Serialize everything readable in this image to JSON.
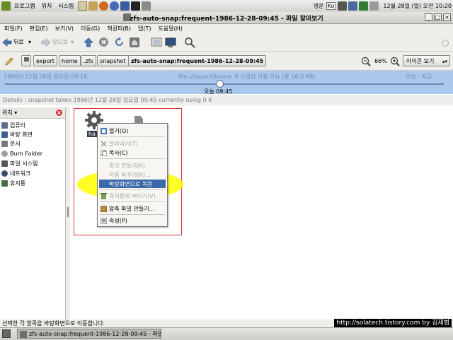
{
  "top_panel": {
    "menus": [
      "프로그램",
      "위치",
      "시스템"
    ],
    "right": {
      "user": "명운",
      "kb": "Ko",
      "date_time": "12월 28일 (일) 오전 10:20"
    }
  },
  "window": {
    "title": "zfs-auto-snap:frequent-1986-12-28-09:45 - 파일 찾아보기",
    "buttons": [
      "_",
      "□",
      "×"
    ]
  },
  "menubar": [
    "파일(F)",
    "편집(E)",
    "보기(V)",
    "이동(G)",
    "책갈피(B)",
    "탭(T)",
    "도움말(H)"
  ],
  "nav": {
    "back": "뒤로",
    "forward": "앞으로"
  },
  "location": {
    "crumbs": [
      "export",
      "home",
      ".zfs",
      "snapshot",
      "zfs-auto-snap:frequent-1986-12-28-09:45"
    ],
    "zoom": "66%",
    "view_mode": "아이콘 보기"
  },
  "timeline": {
    "left_date": "1986년 12월 28일 일요일 09:18",
    "center_info": "file:///export/home: 8 스냅샷 사용 가능 (총 16.0 KB)",
    "right_date": "오늘 - 지금",
    "current_time": "오늘 09:45",
    "position_fraction": 0.485
  },
  "details": "Details : snapshot taken 1986년 12월 28일 일요일 09:45 currently using 0 K",
  "sidebar": {
    "header": "위치",
    "items": [
      {
        "label": "컴퓨터",
        "icon": "computer-icon",
        "color": "#5a6e8c"
      },
      {
        "label": "바탕 화면",
        "icon": "desktop-icon",
        "color": "#3f5f95"
      },
      {
        "label": "문서",
        "icon": "documents-icon",
        "color": "#7a7a7a"
      },
      {
        "label": "Burn Folder",
        "icon": "burn-folder-icon",
        "color": "#a0a0a0"
      },
      {
        "label": "파일 시스템",
        "icon": "filesystem-icon",
        "color": "#555555"
      },
      {
        "label": "네트워크",
        "icon": "network-icon",
        "color": "#3a4c6e"
      },
      {
        "label": "휴지통",
        "icon": "trash-icon",
        "color": "#4b6b48"
      }
    ]
  },
  "content": {
    "icon_label_partial": "ha"
  },
  "context_menu": {
    "items": [
      {
        "label": "열기(O)",
        "icon": "open-icon",
        "state": "normal"
      },
      {
        "label": "잘라내기(T)",
        "icon": "cut-icon",
        "state": "disabled"
      },
      {
        "label": "복사(C)",
        "icon": "copy-icon",
        "state": "normal"
      },
      {
        "label": "링크 만들기(K)",
        "icon": "",
        "state": "disabled"
      },
      {
        "label": "이름 바꾸기(R)...",
        "icon": "",
        "state": "disabled"
      },
      {
        "label": "바탕화면으로 복원",
        "icon": "",
        "state": "selected"
      },
      {
        "label": "휴지통에 버리기(V)",
        "icon": "trash-icon",
        "state": "disabled"
      },
      {
        "label": "압축 파일 만들기...",
        "icon": "archive-icon",
        "state": "normal"
      },
      {
        "label": "속성(P)",
        "icon": "properties-icon",
        "state": "normal"
      }
    ]
  },
  "statusbar": "선택한 각 항목을 바탕화면으로 이동합니다.",
  "watermark": "http://solatech.tistory.com by 김재범",
  "taskbar": {
    "item": "zfs-auto-snap:frequent-1986-12-28-09:45 - 파일"
  },
  "colors": {
    "highlight": "#ffff00",
    "selection": "#3a68a8",
    "timeline_bg": "#a9c8eb",
    "select_box": "#e0303c"
  }
}
